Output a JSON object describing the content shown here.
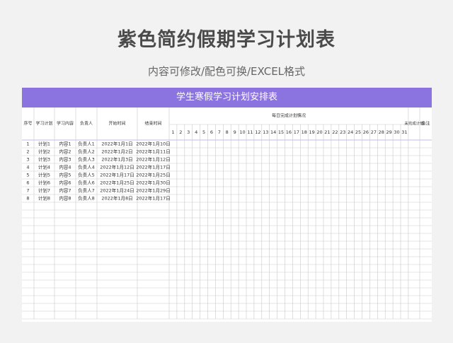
{
  "page": {
    "title": "紫色简约假期学习计划表",
    "subtitle": "内容可修改/配色可换/EXCEL格式"
  },
  "sheet": {
    "banner_title": "学生寒假学习计划安排表",
    "headers": {
      "seq": "序号",
      "plan": "学习计划",
      "content": "学习内容",
      "owner": "负责人",
      "start": "开始时间",
      "end": "结束时间",
      "daily": "每日完成计划情况",
      "unfinished": "未完成计划",
      "note": "备注"
    },
    "days": [
      "1",
      "2",
      "3",
      "4",
      "5",
      "6",
      "7",
      "8",
      "9",
      "10",
      "11",
      "12",
      "13",
      "14",
      "15",
      "16",
      "17",
      "18",
      "19",
      "20",
      "21",
      "22",
      "23",
      "24",
      "25",
      "26",
      "27",
      "28",
      "29",
      "30",
      "31"
    ],
    "rows": [
      {
        "seq": "1",
        "plan": "计划1",
        "content": "内容1",
        "owner": "负责人1",
        "start": "2022年1月1日",
        "end": "2022年1月10日"
      },
      {
        "seq": "2",
        "plan": "计划2",
        "content": "内容2",
        "owner": "负责人2",
        "start": "2022年1月2日",
        "end": "2022年1月11日"
      },
      {
        "seq": "3",
        "plan": "计划3",
        "content": "内容3",
        "owner": "负责人3",
        "start": "2022年1月3日",
        "end": "2022年1月12日"
      },
      {
        "seq": "4",
        "plan": "计划4",
        "content": "内容4",
        "owner": "负责人4",
        "start": "2022年1月12日",
        "end": "2022年1月17日"
      },
      {
        "seq": "5",
        "plan": "计划5",
        "content": "内容5",
        "owner": "负责人5",
        "start": "2022年1月17日",
        "end": "2022年1月25日"
      },
      {
        "seq": "6",
        "plan": "计划6",
        "content": "内容6",
        "owner": "负责人6",
        "start": "2022年1月25日",
        "end": "2022年1月30日"
      },
      {
        "seq": "7",
        "plan": "计划7",
        "content": "内容7",
        "owner": "负责人7",
        "start": "2022年1月24日",
        "end": "2022年1月29日"
      },
      {
        "seq": "8",
        "plan": "计划8",
        "content": "内容8",
        "owner": "负责人8",
        "start": "2022年1月8日",
        "end": "2022年1月17日"
      }
    ],
    "empty_rows": 15,
    "colors": {
      "accent": "#8b74e0",
      "grid": "#c9c9c9",
      "text": "#333333"
    }
  }
}
